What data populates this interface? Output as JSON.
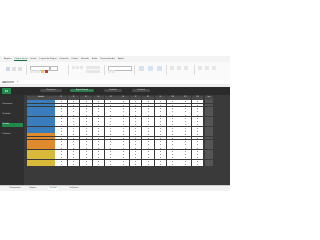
{
  "ribbon": {
    "tabs": [
      "Arquivo",
      "Página Inicial",
      "Inserir",
      "Layout da Página",
      "Fórmulas",
      "Dados",
      "Revisão",
      "Exibir",
      "Desenvolvedor",
      "Ajuda"
    ],
    "active_tab": "Página Inicial"
  },
  "formula_bar": {
    "name_box": "A1",
    "fx": "fx"
  },
  "app": {
    "logo": "FI",
    "nav": [
      "Planejamento",
      "Registro Semanal",
      "Resultados",
      "Dashboard"
    ],
    "active_nav": "Registro Semanal",
    "sidebar": [
      "Planejamento",
      "Resultados",
      "Checklist",
      "Dashboard"
    ],
    "active_sidebar": "Checklist"
  },
  "table": {
    "headers": [
      "Atividade",
      "S1",
      "S2",
      "S3",
      "S4",
      "S5",
      "S6",
      "S7",
      "S8",
      "S9",
      "S10",
      "S11",
      "S12",
      "Total"
    ],
    "rows": [
      {
        "label": "Atividade 01",
        "color": "#3a7dbd"
      },
      {
        "label": "Atividade 02",
        "color": "#3a7dbd"
      },
      {
        "label": "Atividade 03",
        "color": "#3a7dbd"
      },
      {
        "label": "Atividade 04",
        "color": "#3a7dbd"
      },
      {
        "label": "Atividade 05",
        "color": "#3a7dbd"
      },
      {
        "label": "Atividade 06",
        "color": "#3a7dbd"
      },
      {
        "label": "Atividade 07",
        "color": "#3a7dbd"
      },
      {
        "label": "Atividade 08",
        "color": "#3a7dbd"
      },
      {
        "label": "Atividade 09",
        "color": "#3a7dbd"
      },
      {
        "label": "Atividade 10",
        "color": "#3a7dbd"
      },
      {
        "label": "Atividade 11",
        "color": "#e08a2e"
      },
      {
        "label": "Atividade 12",
        "color": "#e08a2e"
      },
      {
        "label": "Atividade 13",
        "color": "#e08a2e"
      },
      {
        "label": "Atividade 14",
        "color": "#e08a2e"
      },
      {
        "label": "Atividade 15",
        "color": "#e08a2e"
      },
      {
        "label": "Atividade 16",
        "color": "#d9b93a"
      },
      {
        "label": "Atividade 17",
        "color": "#d9b93a"
      },
      {
        "label": "Atividade 18",
        "color": "#d9b93a"
      },
      {
        "label": "Atividade 19",
        "color": "#d9b93a"
      },
      {
        "label": "Atividade 20",
        "color": "#d9b93a"
      }
    ]
  },
  "sheet_tabs": [
    "Planejamento",
    "Registro",
    "Checklist",
    "Dashboard"
  ],
  "active_sheet": "Checklist"
}
